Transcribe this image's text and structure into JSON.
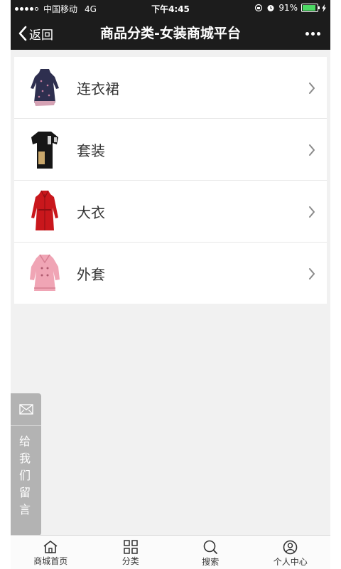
{
  "statusbar": {
    "carrier": "中国移动",
    "network": "4G",
    "time": "下午4:45",
    "battery": "91%",
    "battery_level": 0.91,
    "signal_dots": 4
  },
  "navbar": {
    "back_label": "返回",
    "title": "商品分类-女装商城平台"
  },
  "categories": [
    {
      "label": "连衣裙",
      "icon": "dress-thumbnail"
    },
    {
      "label": "套装",
      "icon": "suit-thumbnail"
    },
    {
      "label": "大衣",
      "icon": "red-coat-thumbnail"
    },
    {
      "label": "外套",
      "icon": "pink-jacket-thumbnail"
    }
  ],
  "feedback": {
    "label": "给我们留言"
  },
  "tabbar": {
    "items": [
      {
        "label": "商城首页",
        "icon": "home-icon"
      },
      {
        "label": "分类",
        "icon": "grid-icon"
      },
      {
        "label": "搜索",
        "icon": "search-icon"
      },
      {
        "label": "个人中心",
        "icon": "user-icon"
      }
    ]
  },
  "colors": {
    "header": "#1c1c1c",
    "background": "#f1f1f1",
    "feedback": "#b3b3b3",
    "battery": "#4cd964"
  }
}
